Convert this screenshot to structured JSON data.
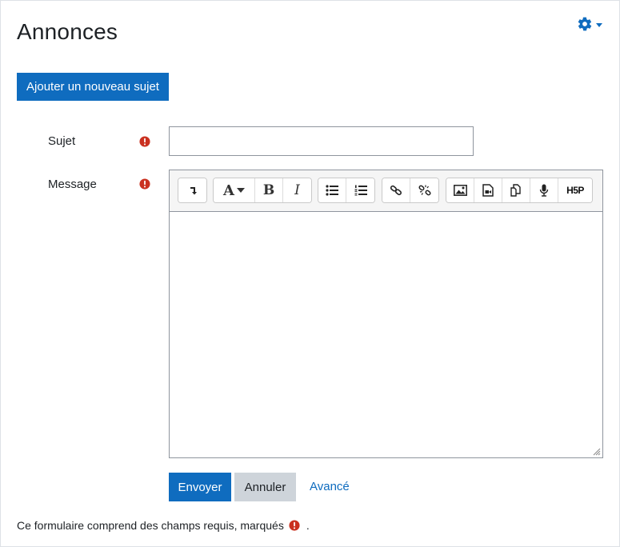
{
  "page": {
    "title": "Annonces"
  },
  "header": {
    "settings_icon": "gear-icon",
    "settings_caret_icon": "caret-down-icon"
  },
  "actions": {
    "add_topic_label": "Ajouter un nouveau sujet"
  },
  "form": {
    "subject_label": "Sujet",
    "subject_value": "",
    "message_label": "Message",
    "message_value": "",
    "required_icon": "exclamation-circle-icon"
  },
  "toolbar": {
    "groups": [
      [
        "collapse-icon"
      ],
      [
        "text-style-icon",
        "bold-icon",
        "italic-icon"
      ],
      [
        "bullet-list-icon",
        "numbered-list-icon"
      ],
      [
        "link-icon",
        "unlink-icon"
      ],
      [
        "image-icon",
        "media-icon",
        "manage-files-icon",
        "record-audio-icon",
        "h5p-icon"
      ]
    ],
    "font_letter": "A",
    "bold_letter": "B",
    "italic_letter": "I",
    "h5p_text": "H5P"
  },
  "buttons": {
    "submit_label": "Envoyer",
    "cancel_label": "Annuler",
    "advanced_label": "Avancé"
  },
  "footer": {
    "required_note_prefix": "Ce formulaire comprend des champs requis, marqués",
    "required_note_suffix": "."
  },
  "colors": {
    "primary": "#0f6cbf",
    "required": "#ca3120",
    "secondary_button": "#ced4da"
  }
}
